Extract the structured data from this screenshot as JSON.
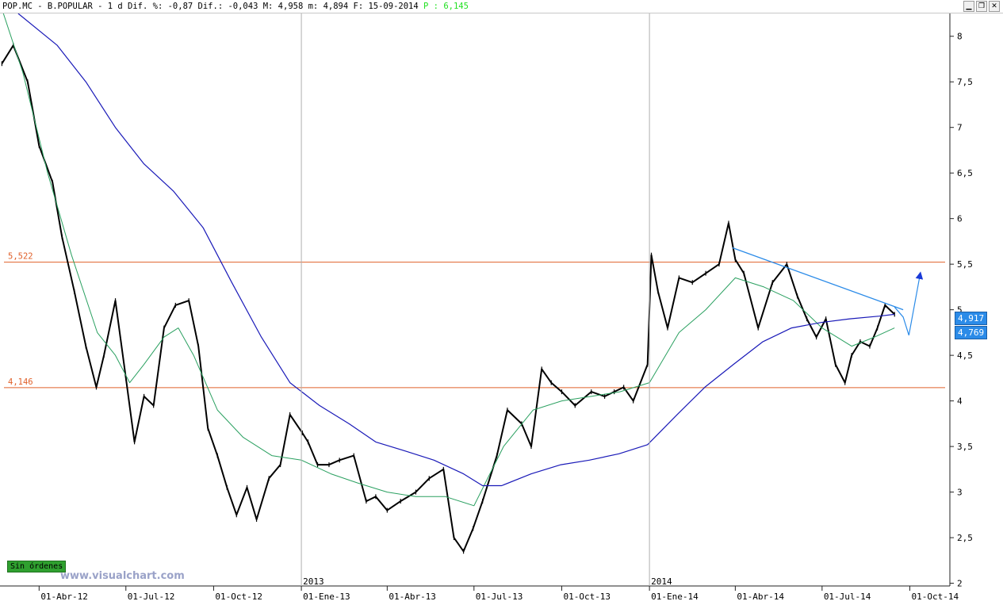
{
  "titlebar": {
    "text": "POP.MC - B.POPULAR -  1 d Dif. %: -0,87 Dif.: -0,043 M: 4,958 m: 4,894 F: 15-09-2014",
    "p_label": "P :",
    "p_value": "6,145"
  },
  "window_buttons": {
    "minimize": "▁",
    "restore": "❐",
    "close": "✕"
  },
  "colors": {
    "price": "#000000",
    "ma_fast": "#2aa060",
    "ma_slow": "#1a1ab8",
    "level_lines": "#e0602a",
    "trendline": "#2b8be8",
    "price_tags": "#2b8be8",
    "badge": "#2fa02f"
  },
  "badges": {
    "sin_ordenes": "Sin órdenes"
  },
  "watermark": "www.visualchart.com",
  "price_tags": [
    "4,917",
    "4,769"
  ],
  "chart_data": {
    "type": "line",
    "title": "POP.MC - B.POPULAR",
    "y_axis_side": "right",
    "ylim": [
      1.97,
      8.25
    ],
    "y_ticks": [
      2,
      2.5,
      3,
      3.5,
      4,
      4.5,
      5,
      5.5,
      6,
      6.5,
      7,
      7.5,
      8
    ],
    "y_tick_labels": [
      "2",
      "2,5",
      "3",
      "3,5",
      "4",
      "4,5",
      "5",
      "5,5",
      "6",
      "6,5",
      "7",
      "7,5",
      "8"
    ],
    "x_range": [
      "2012-02-20",
      "2014-11-12"
    ],
    "x_ticks": [
      "2012-04-01",
      "2012-07-01",
      "2012-10-01",
      "2013-01-01",
      "2013-04-01",
      "2013-07-01",
      "2013-10-01",
      "2014-01-01",
      "2014-04-01",
      "2014-07-01",
      "2014-10-01"
    ],
    "x_tick_labels": [
      "01-Abr-12",
      "01-Jul-12",
      "01-Oct-12",
      "01-Ene-13",
      "01-Abr-13",
      "01-Jul-13",
      "01-Oct-13",
      "01-Ene-14",
      "01-Abr-14",
      "01-Jul-14",
      "01-Oct-14"
    ],
    "year_markers": [
      {
        "date": "2013-01-01",
        "label": "2013"
      },
      {
        "date": "2014-01-01",
        "label": "2014"
      }
    ],
    "grid": false,
    "horizontal_levels": [
      {
        "value": 5.522,
        "label": "5,522"
      },
      {
        "value": 4.146,
        "label": "4,146"
      }
    ],
    "series": [
      {
        "type": "line",
        "role": "price",
        "x": [
          "2012-02-22",
          "2012-03-05",
          "2012-03-20",
          "2012-04-01",
          "2012-04-15",
          "2012-04-25",
          "2012-05-08",
          "2012-05-20",
          "2012-05-31",
          "2012-06-08",
          "2012-06-20",
          "2012-07-01",
          "2012-07-10",
          "2012-07-20",
          "2012-07-30",
          "2012-08-10",
          "2012-08-22",
          "2012-09-05",
          "2012-09-15",
          "2012-09-25",
          "2012-10-05",
          "2012-10-15",
          "2012-10-25",
          "2012-11-05",
          "2012-11-15",
          "2012-11-28",
          "2012-12-10",
          "2012-12-20",
          "2013-01-02",
          "2013-01-08",
          "2013-01-18",
          "2013-01-30",
          "2013-02-10",
          "2013-02-25",
          "2013-03-10",
          "2013-03-20",
          "2013-04-01",
          "2013-04-15",
          "2013-05-01",
          "2013-05-15",
          "2013-05-30",
          "2013-06-10",
          "2013-06-20",
          "2013-06-30",
          "2013-07-10",
          "2013-07-25",
          "2013-08-05",
          "2013-08-20",
          "2013-08-30",
          "2013-09-10",
          "2013-09-20",
          "2013-10-01",
          "2013-10-15",
          "2013-11-01",
          "2013-11-15",
          "2013-11-25",
          "2013-12-05",
          "2013-12-15",
          "2013-12-30",
          "2014-01-03",
          "2014-01-10",
          "2014-01-20",
          "2014-02-01",
          "2014-02-15",
          "2014-03-01",
          "2014-03-15",
          "2014-03-25",
          "2014-04-01",
          "2014-04-10",
          "2014-04-25",
          "2014-05-10",
          "2014-05-25",
          "2014-06-05",
          "2014-06-15",
          "2014-06-25",
          "2014-07-05",
          "2014-07-15",
          "2014-07-25",
          "2014-08-01",
          "2014-08-10",
          "2014-08-20",
          "2014-08-28",
          "2014-09-05",
          "2014-09-15"
        ],
        "values": [
          7.7,
          7.9,
          7.5,
          6.8,
          6.4,
          5.8,
          5.2,
          4.6,
          4.15,
          4.5,
          5.1,
          4.25,
          3.55,
          4.05,
          3.95,
          4.8,
          5.05,
          5.1,
          4.6,
          3.7,
          3.4,
          3.05,
          2.75,
          3.05,
          2.7,
          3.15,
          3.3,
          3.85,
          3.65,
          3.55,
          3.3,
          3.3,
          3.35,
          3.4,
          2.9,
          2.95,
          2.8,
          2.9,
          3.0,
          3.15,
          3.25,
          2.5,
          2.35,
          2.6,
          2.9,
          3.4,
          3.9,
          3.75,
          3.5,
          4.35,
          4.2,
          4.1,
          3.95,
          4.1,
          4.05,
          4.1,
          4.15,
          4.0,
          4.4,
          5.6,
          5.2,
          4.8,
          5.35,
          5.3,
          5.4,
          5.5,
          5.95,
          5.55,
          5.4,
          4.8,
          5.3,
          5.5,
          5.15,
          4.9,
          4.7,
          4.9,
          4.4,
          4.2,
          4.5,
          4.65,
          4.6,
          4.8,
          5.05,
          4.95
        ]
      },
      {
        "type": "line",
        "role": "moving-average-fast",
        "x": [
          "2012-02-22",
          "2012-03-15",
          "2012-04-10",
          "2012-05-05",
          "2012-06-01",
          "2012-06-20",
          "2012-07-05",
          "2012-07-20",
          "2012-08-10",
          "2012-08-25",
          "2012-09-10",
          "2012-10-05",
          "2012-11-01",
          "2012-12-01",
          "2013-01-01",
          "2013-02-01",
          "2013-03-01",
          "2013-04-01",
          "2013-05-01",
          "2013-06-01",
          "2013-07-01",
          "2013-08-01",
          "2013-09-01",
          "2013-10-01",
          "2013-11-01",
          "2013-12-01",
          "2014-01-01",
          "2014-02-01",
          "2014-03-01",
          "2014-04-01",
          "2014-05-01",
          "2014-06-01",
          "2014-07-01",
          "2014-08-01",
          "2014-08-25",
          "2014-09-15"
        ],
        "values": [
          8.3,
          7.6,
          6.5,
          5.6,
          4.75,
          4.5,
          4.2,
          4.4,
          4.7,
          4.8,
          4.5,
          3.9,
          3.6,
          3.4,
          3.35,
          3.2,
          3.1,
          3.0,
          2.95,
          2.95,
          2.85,
          3.5,
          3.9,
          4.0,
          4.05,
          4.1,
          4.2,
          4.75,
          5.0,
          5.35,
          5.25,
          5.1,
          4.8,
          4.6,
          4.7,
          4.8
        ]
      },
      {
        "type": "line",
        "role": "moving-average-slow",
        "x": [
          "2012-03-10",
          "2012-04-20",
          "2012-05-20",
          "2012-06-20",
          "2012-07-20",
          "2012-08-20",
          "2012-09-20",
          "2012-10-20",
          "2012-11-20",
          "2012-12-20",
          "2013-01-20",
          "2013-02-20",
          "2013-03-20",
          "2013-04-20",
          "2013-05-20",
          "2013-06-20",
          "2013-07-10",
          "2013-07-30",
          "2013-08-30",
          "2013-09-30",
          "2013-10-30",
          "2013-11-30",
          "2013-12-30",
          "2014-01-30",
          "2014-02-28",
          "2014-03-30",
          "2014-04-30",
          "2014-05-30",
          "2014-06-30",
          "2014-07-30",
          "2014-08-30",
          "2014-09-15"
        ],
        "values": [
          8.25,
          7.9,
          7.5,
          7.0,
          6.6,
          6.3,
          5.9,
          5.3,
          4.7,
          4.2,
          3.95,
          3.75,
          3.55,
          3.45,
          3.35,
          3.2,
          3.07,
          3.07,
          3.2,
          3.3,
          3.35,
          3.42,
          3.52,
          3.85,
          4.15,
          4.4,
          4.65,
          4.8,
          4.86,
          4.9,
          4.93,
          4.95
        ]
      }
    ],
    "annotations": [
      {
        "type": "trendline",
        "points": [
          [
            "2014-03-29",
            5.68
          ],
          [
            "2014-09-24",
            5.0
          ]
        ]
      },
      {
        "type": "projection-arrow",
        "points": [
          [
            "2014-09-15",
            5.03
          ],
          [
            "2014-09-24",
            4.92
          ],
          [
            "2014-09-30",
            4.72
          ],
          [
            "2014-10-12",
            5.4
          ]
        ]
      }
    ]
  }
}
